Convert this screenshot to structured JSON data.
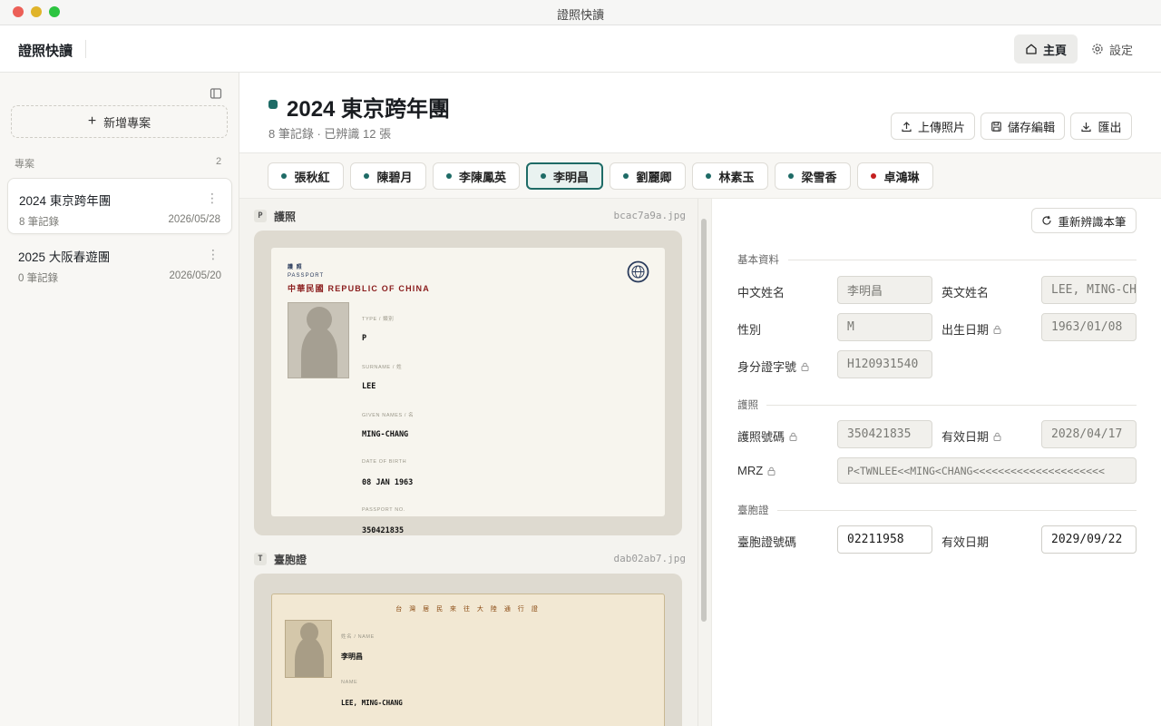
{
  "window": {
    "title": "證照快讀"
  },
  "header": {
    "app_name": "證照快讀",
    "nav": {
      "home": "主頁",
      "settings": "設定"
    }
  },
  "sidebar": {
    "new_project": "新增專案",
    "section_label": "專案",
    "section_count": "2",
    "projects": [
      {
        "title": "2024 東京跨年團",
        "meta": "8 筆記錄",
        "date": "2026/05/28"
      },
      {
        "title": "2025 大阪春遊團",
        "meta": "0 筆記錄",
        "date": "2026/05/20"
      }
    ]
  },
  "project": {
    "title": "2024 東京跨年團",
    "subtitle": "8 筆記錄 · 已辨識 12 張",
    "actions": {
      "upload": "上傳照片",
      "save": "儲存編輯",
      "export": "匯出"
    }
  },
  "people_tabs": [
    {
      "name": "張秋紅"
    },
    {
      "name": "陳碧月"
    },
    {
      "name": "李陳鳳英"
    },
    {
      "name": "李明昌"
    },
    {
      "name": "劉麗卿"
    },
    {
      "name": "林素玉"
    },
    {
      "name": "梁雪香"
    },
    {
      "name": "卓鴻琳"
    }
  ],
  "documents": {
    "passport": {
      "badge": "P",
      "label": "護照",
      "file": "bcac7a9a.jpg",
      "card": {
        "header_cn": "護 照",
        "header_en": "PASSPORT",
        "country": "中華民國 REPUBLIC OF CHINA",
        "fields": [
          {
            "label": "TYPE / 類別",
            "value": "P"
          },
          {
            "label": "SURNAME / 姓",
            "value": "LEE"
          },
          {
            "label": "GIVEN NAMES / 名",
            "value": "MING-CHANG"
          },
          {
            "label": "DATE OF BIRTH",
            "value": "08 JAN 1963"
          },
          {
            "label": "PASSPORT NO.",
            "value": "350421835"
          }
        ]
      }
    },
    "permit": {
      "badge": "T",
      "label": "臺胞證",
      "file": "dab02ab7.jpg",
      "card": {
        "title": "台 灣 居 民 來 往 大 陸 通 行 證",
        "fields": [
          {
            "label": "姓名 / NAME",
            "value": "李明昌"
          },
          {
            "label": "NAME",
            "value": "LEE, MING-CHANG"
          }
        ]
      }
    }
  },
  "form": {
    "reocr": "重新辨識本筆",
    "groups": {
      "basic": "基本資料",
      "passport": "護照",
      "permit": "臺胞證"
    },
    "fields": {
      "chinese_name": {
        "label": "中文姓名",
        "value": "李明昌"
      },
      "english_name": {
        "label": "英文姓名",
        "value": "LEE, MING-CHANG"
      },
      "gender": {
        "label": "性別",
        "value": "M"
      },
      "birth_date": {
        "label": "出生日期",
        "value": "1963/01/08"
      },
      "id_number": {
        "label": "身分證字號",
        "value": "H120931540"
      },
      "passport_no": {
        "label": "護照號碼",
        "value": "350421835"
      },
      "passport_expiry": {
        "label": "有效日期",
        "value": "2028/04/17"
      },
      "mrz": {
        "label": "MRZ",
        "value": "P<TWNLEE<<MING<CHANG<<<<<<<<<<<<<<<<<<<<<"
      },
      "permit_no": {
        "label": "臺胞證號碼",
        "value": "02211958"
      },
      "permit_expiry": {
        "label": "有效日期",
        "value": "2029/09/22"
      }
    }
  },
  "colors": {
    "accent": "#1e6b66",
    "alert_dot": "#c41f1f"
  }
}
